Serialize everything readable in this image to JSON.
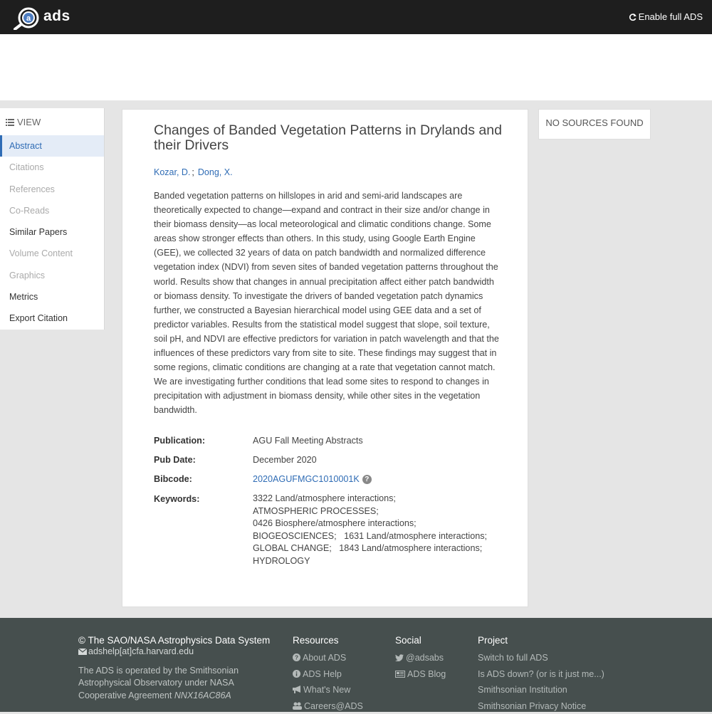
{
  "header": {
    "brand": "ads",
    "enable_full": "Enable full ADS",
    "logo_letter": "a"
  },
  "sidebar": {
    "heading": "VIEW",
    "items": [
      {
        "label": "Abstract",
        "state": "active"
      },
      {
        "label": "Citations",
        "state": "disabled"
      },
      {
        "label": "References",
        "state": "disabled"
      },
      {
        "label": "Co-Reads",
        "state": "disabled"
      },
      {
        "label": "Similar Papers",
        "state": "enabled"
      },
      {
        "label": "Volume Content",
        "state": "disabled"
      },
      {
        "label": "Graphics",
        "state": "disabled"
      },
      {
        "label": "Metrics",
        "state": "enabled"
      },
      {
        "label": "Export Citation",
        "state": "enabled"
      }
    ]
  },
  "paper": {
    "title": "Changes of Banded Vegetation Patterns in Drylands and their Drivers",
    "authors": [
      "Kozar, D.",
      "Dong, X."
    ],
    "author_sep": ";",
    "abstract": "Banded vegetation patterns on hillslopes in arid and semi-arid landscapes are theoretically expected to change—expand and contract in their size and/or change in their biomass density—as local meteorological and climatic conditions change. Some areas show stronger effects than others. In this study, using Google Earth Engine (GEE), we collected 32 years of data on patch bandwidth and normalized difference vegetation index (NDVI) from seven sites of banded vegetation patterns throughout the world. Results show that changes in annual precipitation affect either patch bandwidth or biomass density. To investigate the drivers of banded vegetation patch dynamics further, we constructed a Bayesian hierarchical model using GEE data and a set of predictor variables. Results from the statistical model suggest that slope, soil texture, soil pH, and NDVI are effective predictors for variation in patch wavelength and that the influences of these predictors vary from site to site. These findings may suggest that in some regions, climatic conditions are changing at a rate that vegetation cannot match. We are investigating further conditions that lead some sites to respond to changes in precipitation with adjustment in biomass density, while other sites in the vegetation bandwidth.",
    "publication_label": "Publication:",
    "publication": "AGU Fall Meeting Abstracts",
    "pubdate_label": "Pub Date:",
    "pubdate": "December 2020",
    "bibcode_label": "Bibcode:",
    "bibcode": "2020AGUFMGC1010001K",
    "keywords_label": "Keywords:",
    "keywords_lines": [
      "3322 Land/atmosphere interactions;",
      "ATMOSPHERIC PROCESSES;",
      "0426 Biosphere/atmosphere interactions;",
      "BIOGEOSCIENCES;   1631 Land/atmosphere interactions;",
      "GLOBAL CHANGE;   1843 Land/atmosphere interactions;",
      "HYDROLOGY"
    ]
  },
  "sources": {
    "text": "NO SOURCES FOUND"
  },
  "footer": {
    "copyright": "© The SAO/NASA Astrophysics Data System",
    "email": "adshelp[at]cfa.harvard.edu",
    "operated_1": "The ADS is operated by the Smithsonian",
    "operated_2": "Astrophysical Observatory under NASA",
    "operated_3": "Cooperative Agreement",
    "agreement": "NNX16AC86A",
    "resources": {
      "heading": "Resources",
      "links": [
        "About ADS",
        "ADS Help",
        "What's New",
        "Careers@ADS"
      ]
    },
    "social": {
      "heading": "Social",
      "links": [
        "@adsabs",
        "ADS Blog"
      ]
    },
    "project": {
      "heading": "Project",
      "links": [
        "Switch to full ADS",
        "Is ADS down? (or is it just me...)",
        "Smithsonian Institution",
        "Smithsonian Privacy Notice"
      ]
    }
  },
  "colors": {
    "link": "#2f6cb5",
    "topbar": "#1e1e1e",
    "footer": "#464f4e",
    "page": "#e5e5e5"
  },
  "icons": [
    "refresh-icon",
    "list-icon",
    "help-icon",
    "envelope-icon",
    "question-circle-icon",
    "info-circle-icon",
    "bullhorn-icon",
    "users-icon",
    "twitter-icon",
    "newspaper-icon"
  ]
}
